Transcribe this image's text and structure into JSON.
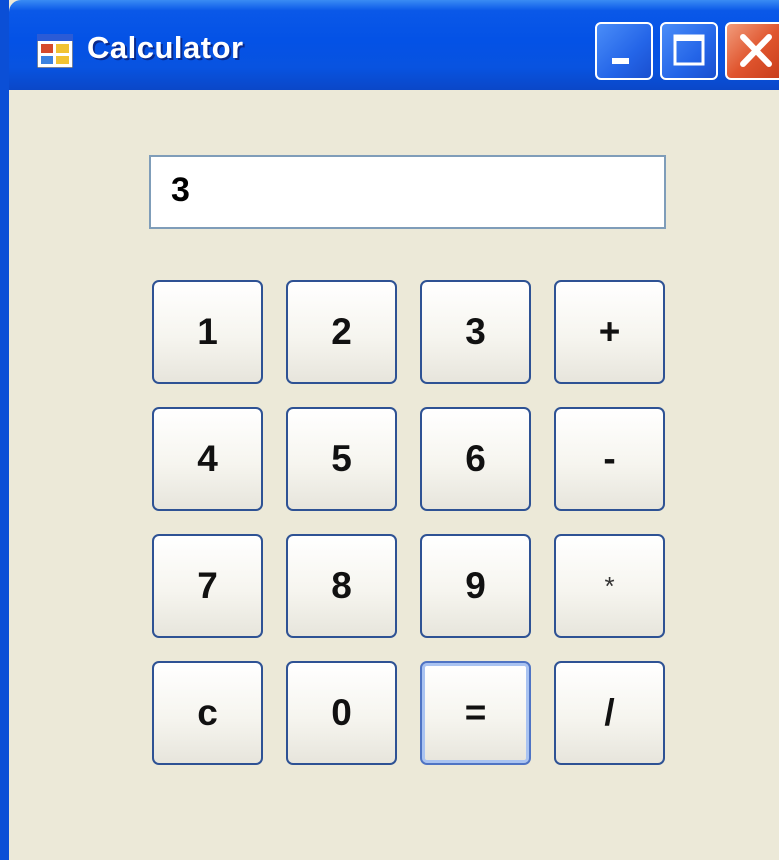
{
  "window": {
    "title": "Calculator",
    "icon": "app-window-icon",
    "controls": [
      {
        "name": "minimize-button",
        "icon": "minimize-icon"
      },
      {
        "name": "maximize-button",
        "icon": "maximize-icon"
      },
      {
        "name": "close-button",
        "icon": "close-icon"
      }
    ]
  },
  "display": {
    "value": "3"
  },
  "keys": [
    {
      "label": "1",
      "name": "key-1"
    },
    {
      "label": "2",
      "name": "key-2"
    },
    {
      "label": "3",
      "name": "key-3"
    },
    {
      "label": "+",
      "name": "key-plus"
    },
    {
      "label": "4",
      "name": "key-4"
    },
    {
      "label": "5",
      "name": "key-5"
    },
    {
      "label": "6",
      "name": "key-6"
    },
    {
      "label": "-",
      "name": "key-minus"
    },
    {
      "label": "7",
      "name": "key-7"
    },
    {
      "label": "8",
      "name": "key-8"
    },
    {
      "label": "9",
      "name": "key-9"
    },
    {
      "label": "*",
      "name": "key-multiply"
    },
    {
      "label": "c",
      "name": "key-clear"
    },
    {
      "label": "0",
      "name": "key-0"
    },
    {
      "label": "=",
      "name": "key-equals",
      "focused": true
    },
    {
      "label": "/",
      "name": "key-divide"
    }
  ],
  "colors": {
    "titlebar": "#0452e6",
    "window_body": "#ece9d8",
    "close_button": "#e0552e",
    "button_border": "#2e5294"
  }
}
